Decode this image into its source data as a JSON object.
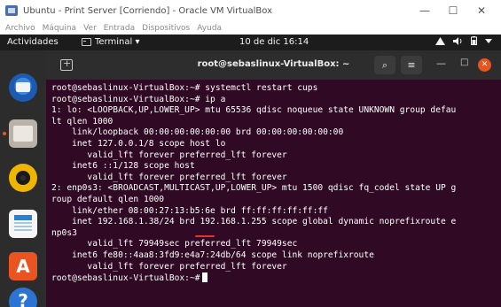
{
  "vbox": {
    "title": "Ubuntu - Print Server [Corriendo] - Oracle VM VirtualBox",
    "menu": [
      "Archivo",
      "Máquina",
      "Ver",
      "Entrada",
      "Dispositivos",
      "Ayuda"
    ],
    "controls": [
      "—",
      "☐",
      "✕"
    ]
  },
  "topbar": {
    "activities": "Actividades",
    "app": "Terminal ▾",
    "clock": "10 de dic  16:14",
    "tray": [
      "network-icon",
      "volume-icon",
      "battery-icon",
      "power-menu-icon"
    ]
  },
  "dock": {
    "items": [
      "thunderbird-icon",
      "files-icon",
      "rhythmbox-icon",
      "writer-icon",
      "software-icon",
      "help-icon"
    ]
  },
  "terminal": {
    "title": "root@sebaslinux-VirtualBox: ~",
    "search_icon": "⌕",
    "menu_icon": "≡",
    "min_icon": "—",
    "max_icon": "□",
    "close_icon": "✕",
    "lines": [
      "root@sebaslinux-VirtualBox:~# systemctl restart cups",
      "root@sebaslinux-VirtualBox:~# ip a",
      "1: lo: <LOOPBACK,UP,LOWER_UP> mtu 65536 qdisc noqueue state UNKNOWN group defau",
      "lt qlen 1000",
      "    link/loopback 00:00:00:00:00:00 brd 00:00:00:00:00:00",
      "    inet 127.0.0.1/8 scope host lo",
      "       valid_lft forever preferred_lft forever",
      "    inet6 ::1/128 scope host",
      "       valid_lft forever preferred_lft forever",
      "2: enp0s3: <BROADCAST,MULTICAST,UP,LOWER_UP> mtu 1500 qdisc fq_codel state UP g",
      "roup default qlen 1000",
      "    link/ether 08:00:27:13:b5:6e brd ff:ff:ff:ff:ff:ff",
      "    inet 192.168.1.38/24 brd 192.168.1.255 scope global dynamic noprefixroute e",
      "np0s3",
      "       valid_lft 79949sec preferred_lft 79949sec",
      "    inet6 fe80::4aa8:3fd9:e4a7:24db/64 scope link noprefixroute",
      "       valid_lft forever preferred_lft forever"
    ],
    "prompt": "root@sebaslinux-VirtualBox:~#"
  },
  "colors": {
    "terminal_bg": "#300a24",
    "accent": "#e95420",
    "annotation": "#e2332d"
  }
}
